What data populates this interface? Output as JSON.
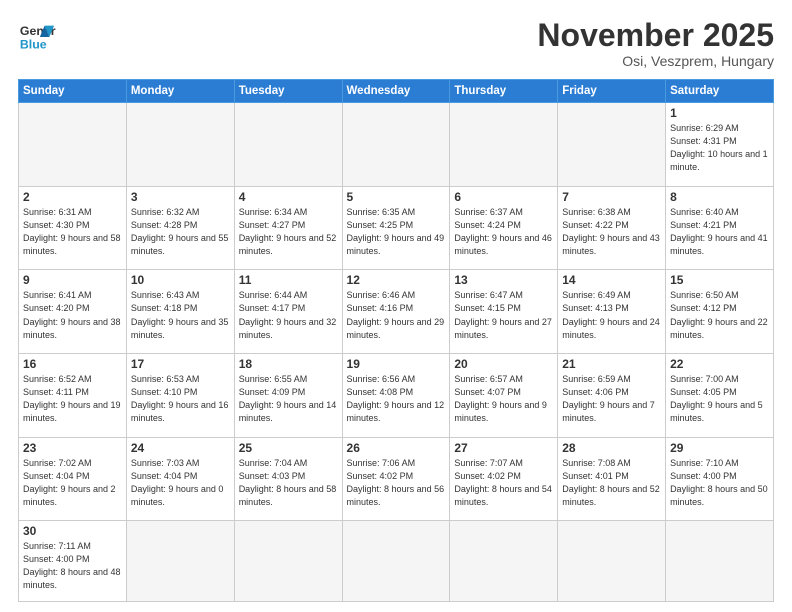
{
  "logo": {
    "text_general": "General",
    "text_blue": "Blue"
  },
  "header": {
    "month": "November 2025",
    "location": "Osi, Veszprem, Hungary"
  },
  "weekdays": [
    "Sunday",
    "Monday",
    "Tuesday",
    "Wednesday",
    "Thursday",
    "Friday",
    "Saturday"
  ],
  "days": [
    {
      "num": "",
      "empty": true
    },
    {
      "num": "",
      "empty": true
    },
    {
      "num": "",
      "empty": true
    },
    {
      "num": "",
      "empty": true
    },
    {
      "num": "",
      "empty": true
    },
    {
      "num": "",
      "empty": true
    },
    {
      "num": "1",
      "sunrise": "6:29 AM",
      "sunset": "4:31 PM",
      "daylight": "10 hours and 1 minute."
    },
    {
      "num": "2",
      "sunrise": "6:31 AM",
      "sunset": "4:30 PM",
      "daylight": "9 hours and 58 minutes."
    },
    {
      "num": "3",
      "sunrise": "6:32 AM",
      "sunset": "4:28 PM",
      "daylight": "9 hours and 55 minutes."
    },
    {
      "num": "4",
      "sunrise": "6:34 AM",
      "sunset": "4:27 PM",
      "daylight": "9 hours and 52 minutes."
    },
    {
      "num": "5",
      "sunrise": "6:35 AM",
      "sunset": "4:25 PM",
      "daylight": "9 hours and 49 minutes."
    },
    {
      "num": "6",
      "sunrise": "6:37 AM",
      "sunset": "4:24 PM",
      "daylight": "9 hours and 46 minutes."
    },
    {
      "num": "7",
      "sunrise": "6:38 AM",
      "sunset": "4:22 PM",
      "daylight": "9 hours and 43 minutes."
    },
    {
      "num": "8",
      "sunrise": "6:40 AM",
      "sunset": "4:21 PM",
      "daylight": "9 hours and 41 minutes."
    },
    {
      "num": "9",
      "sunrise": "6:41 AM",
      "sunset": "4:20 PM",
      "daylight": "9 hours and 38 minutes."
    },
    {
      "num": "10",
      "sunrise": "6:43 AM",
      "sunset": "4:18 PM",
      "daylight": "9 hours and 35 minutes."
    },
    {
      "num": "11",
      "sunrise": "6:44 AM",
      "sunset": "4:17 PM",
      "daylight": "9 hours and 32 minutes."
    },
    {
      "num": "12",
      "sunrise": "6:46 AM",
      "sunset": "4:16 PM",
      "daylight": "9 hours and 29 minutes."
    },
    {
      "num": "13",
      "sunrise": "6:47 AM",
      "sunset": "4:15 PM",
      "daylight": "9 hours and 27 minutes."
    },
    {
      "num": "14",
      "sunrise": "6:49 AM",
      "sunset": "4:13 PM",
      "daylight": "9 hours and 24 minutes."
    },
    {
      "num": "15",
      "sunrise": "6:50 AM",
      "sunset": "4:12 PM",
      "daylight": "9 hours and 22 minutes."
    },
    {
      "num": "16",
      "sunrise": "6:52 AM",
      "sunset": "4:11 PM",
      "daylight": "9 hours and 19 minutes."
    },
    {
      "num": "17",
      "sunrise": "6:53 AM",
      "sunset": "4:10 PM",
      "daylight": "9 hours and 16 minutes."
    },
    {
      "num": "18",
      "sunrise": "6:55 AM",
      "sunset": "4:09 PM",
      "daylight": "9 hours and 14 minutes."
    },
    {
      "num": "19",
      "sunrise": "6:56 AM",
      "sunset": "4:08 PM",
      "daylight": "9 hours and 12 minutes."
    },
    {
      "num": "20",
      "sunrise": "6:57 AM",
      "sunset": "4:07 PM",
      "daylight": "9 hours and 9 minutes."
    },
    {
      "num": "21",
      "sunrise": "6:59 AM",
      "sunset": "4:06 PM",
      "daylight": "9 hours and 7 minutes."
    },
    {
      "num": "22",
      "sunrise": "7:00 AM",
      "sunset": "4:05 PM",
      "daylight": "9 hours and 5 minutes."
    },
    {
      "num": "23",
      "sunrise": "7:02 AM",
      "sunset": "4:04 PM",
      "daylight": "9 hours and 2 minutes."
    },
    {
      "num": "24",
      "sunrise": "7:03 AM",
      "sunset": "4:04 PM",
      "daylight": "9 hours and 0 minutes."
    },
    {
      "num": "25",
      "sunrise": "7:04 AM",
      "sunset": "4:03 PM",
      "daylight": "8 hours and 58 minutes."
    },
    {
      "num": "26",
      "sunrise": "7:06 AM",
      "sunset": "4:02 PM",
      "daylight": "8 hours and 56 minutes."
    },
    {
      "num": "27",
      "sunrise": "7:07 AM",
      "sunset": "4:02 PM",
      "daylight": "8 hours and 54 minutes."
    },
    {
      "num": "28",
      "sunrise": "7:08 AM",
      "sunset": "4:01 PM",
      "daylight": "8 hours and 52 minutes."
    },
    {
      "num": "29",
      "sunrise": "7:10 AM",
      "sunset": "4:00 PM",
      "daylight": "8 hours and 50 minutes."
    },
    {
      "num": "30",
      "sunrise": "7:11 AM",
      "sunset": "4:00 PM",
      "daylight": "8 hours and 48 minutes."
    },
    {
      "num": "",
      "empty": true
    },
    {
      "num": "",
      "empty": true
    },
    {
      "num": "",
      "empty": true
    },
    {
      "num": "",
      "empty": true
    },
    {
      "num": "",
      "empty": true
    },
    {
      "num": "",
      "empty": true
    }
  ]
}
